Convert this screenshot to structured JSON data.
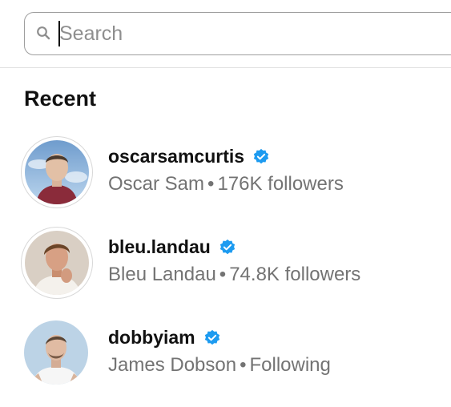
{
  "search": {
    "placeholder": "Search",
    "value": ""
  },
  "recent": {
    "title": "Recent",
    "users": [
      {
        "username": "oscarsamcurtis",
        "verified": true,
        "name": "Oscar Sam",
        "separator": "•",
        "meta": "176K followers",
        "avatar_icon": "avatar-photo"
      },
      {
        "username": "bleu.landau",
        "verified": true,
        "name": "Bleu Landau",
        "separator": "•",
        "meta": "74.8K followers",
        "avatar_icon": "avatar-photo"
      },
      {
        "username": "dobbyiam",
        "verified": true,
        "name": "James Dobson",
        "separator": "•",
        "meta": "Following",
        "avatar_icon": "avatar-photo"
      }
    ]
  },
  "colors": {
    "verified": "#1d9bf0",
    "secondary_text": "#737373",
    "border": "#9e9e9e"
  }
}
